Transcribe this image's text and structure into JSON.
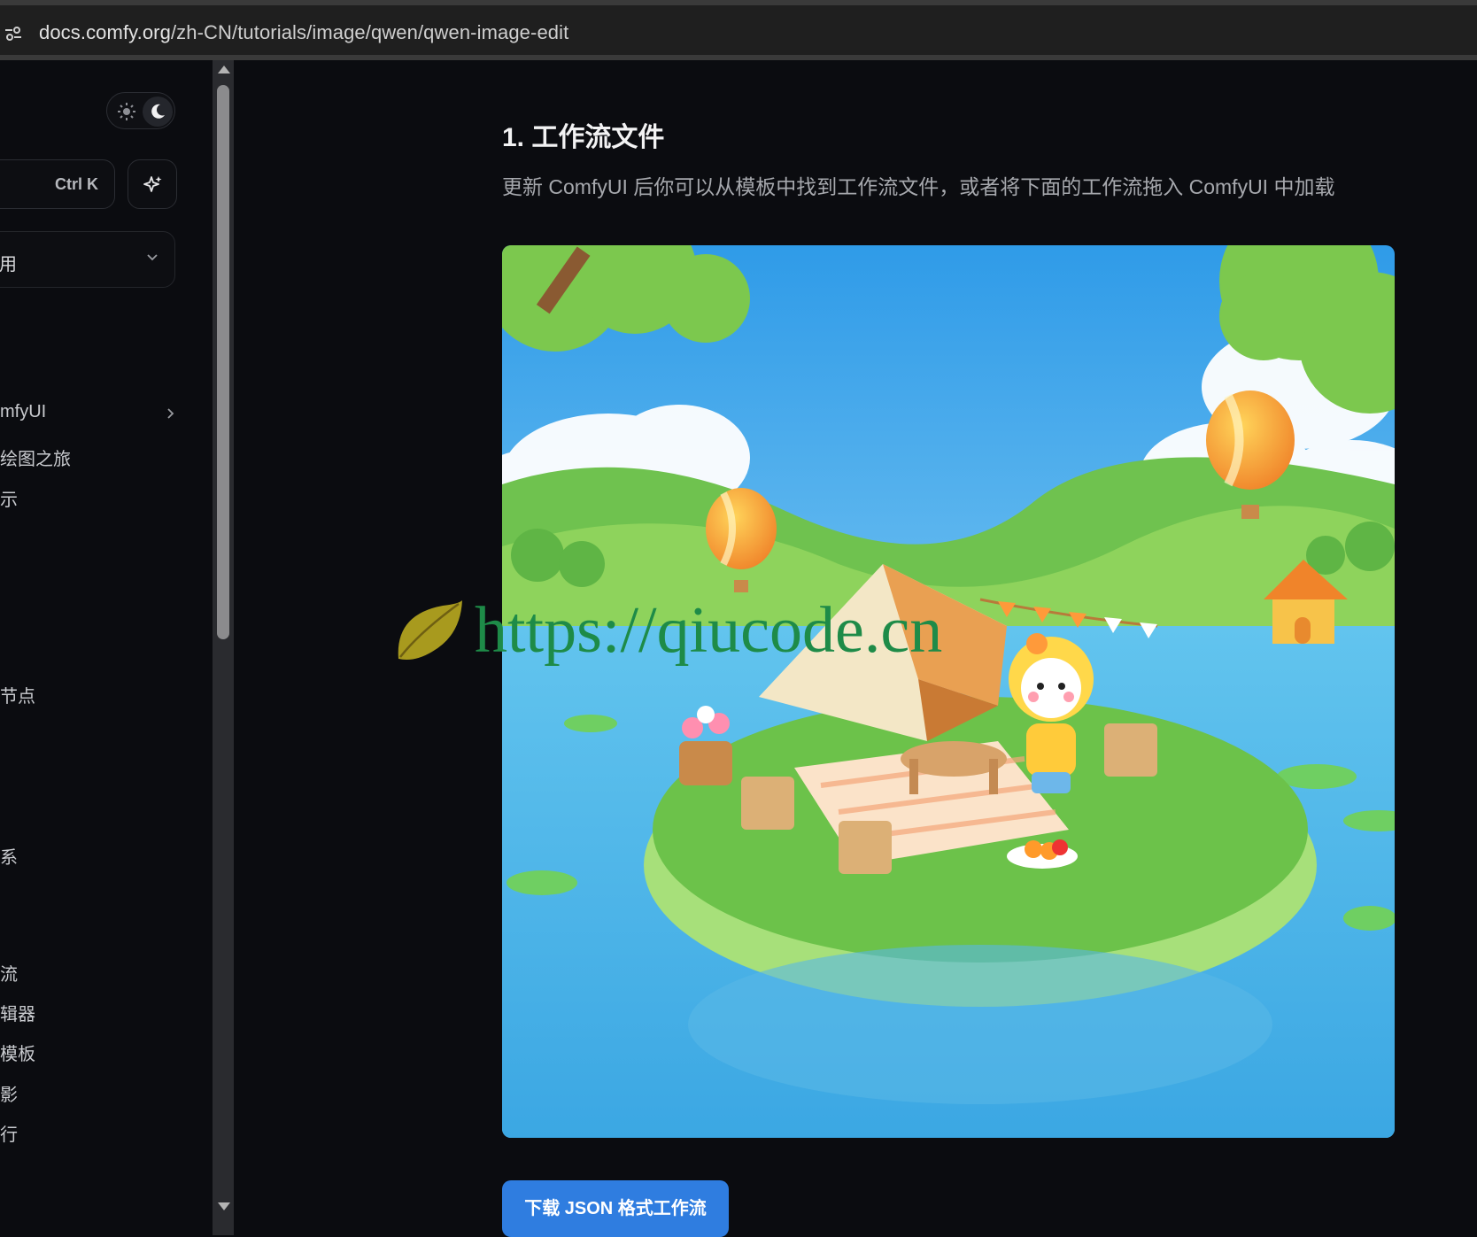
{
  "browser": {
    "url_domain": "docs.comfy.org",
    "url_path": "/zh-CN/tutorials/image/qwen/qwen-image-edit"
  },
  "sidebar": {
    "search_shortcut": "Ctrl K",
    "version_label": "用",
    "items": [
      {
        "label": "mfyUI",
        "has_chevron": true
      },
      {
        "label": "绘图之旅"
      },
      {
        "label": "示"
      },
      {
        "label": "节点"
      },
      {
        "label": "系"
      },
      {
        "label": "流"
      },
      {
        "label": "辑器"
      },
      {
        "label": "模板"
      },
      {
        "label": "影"
      },
      {
        "label": "行"
      }
    ]
  },
  "main": {
    "section_heading": "1. 工作流文件",
    "section_desc": "更新 ComfyUI 后你可以从模板中找到工作流文件，或者将下面的工作流拖入 ComfyUI 中加载",
    "download_button": "下载 JSON 格式工作流"
  },
  "watermark": {
    "text": "https://qiucode.cn"
  },
  "colors": {
    "background": "#0b0c10",
    "accent_button": "#2f7de0",
    "watermark": "#1e8b48"
  }
}
